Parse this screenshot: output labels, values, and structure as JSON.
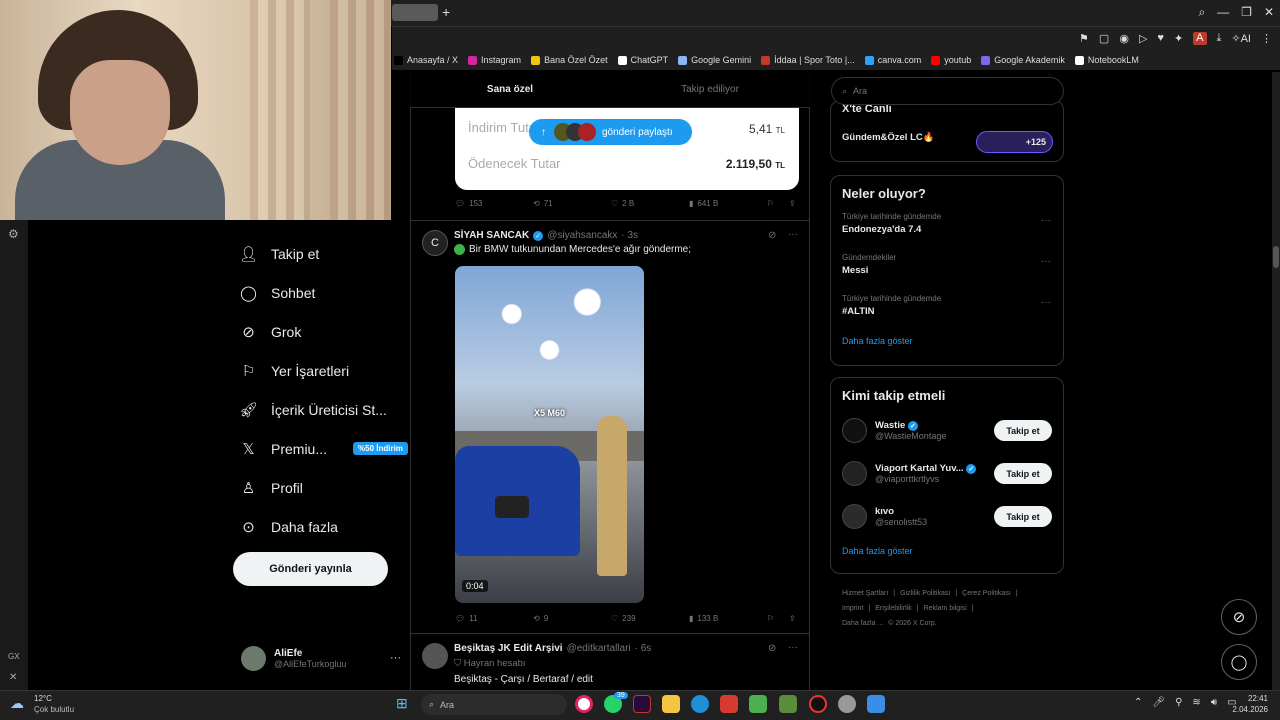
{
  "browser": {
    "bookmarks": [
      "Anasayfa / X",
      "Instagram",
      "Bana Özel Özet",
      "ChatGPT",
      "Google Gemini",
      "İddaa | Spor Toto |...",
      "canva.com",
      "youtub",
      "Google Akademik",
      "NotebookLM"
    ],
    "bookmark_colors": [
      "#000000",
      "#d6249f",
      "#f1c40f",
      "#ffffff",
      "#8ab4f8",
      "#c0392b",
      "#2ba3ff",
      "#ff0000",
      "#7b68ee",
      "#ffffff"
    ]
  },
  "nav": {
    "items": [
      {
        "label": "Takip et",
        "icon": "add-person-icon"
      },
      {
        "label": "Sohbet",
        "icon": "chat-icon"
      },
      {
        "label": "Grok",
        "icon": "grok-icon"
      },
      {
        "label": "Yer İşaretleri",
        "icon": "bookmark-icon"
      },
      {
        "label": "İçerik Üreticisi St...",
        "icon": "rocket-icon"
      },
      {
        "label": "Premiu...",
        "icon": "x-logo-icon"
      },
      {
        "label": "Profil",
        "icon": "person-icon"
      },
      {
        "label": "Daha fazla",
        "icon": "more-circle-icon"
      }
    ],
    "premium_badge": "%50 İndirim",
    "post_button": "Gönderi yayınla"
  },
  "profile": {
    "name": "AliEfe",
    "handle": "@AliEfeTurkogluu",
    "more": "···"
  },
  "feed": {
    "tabs": [
      "Sana özel",
      "Takip ediliyor"
    ],
    "receipt": {
      "row1_label": "İndirim Tutarı",
      "row1_value": "5,41",
      "currency": "TL",
      "row2_label": "Ödenecek Tutar",
      "row2_value": "2.119,50"
    },
    "share_pill": "gönderi paylaştı",
    "tweet1_stats": {
      "replies": "153",
      "reposts": "71",
      "likes": "2 B",
      "views": "641 B"
    },
    "tweet2": {
      "name": "SİYAH SANCAK",
      "handle": "@siyahsancakx",
      "time": "· 3s",
      "text": "Bir BMW tutkunundan Mercedes'e ağır gönderme;",
      "video_caption": "X5 M60",
      "duration": "0:04",
      "stats": {
        "replies": "11",
        "reposts": "9",
        "likes": "239",
        "views": "133 B"
      }
    },
    "tweet3": {
      "name": "Beşiktaş JK Edit Arşivi",
      "handle": "@editkartallari",
      "time": "· 6s",
      "subtitle": "Hayran hesabı",
      "text": "Beşiktaş - Çarşı / Bertaraf / edit"
    }
  },
  "right": {
    "search_placeholder": "Ara",
    "community": {
      "title": "X'te Canlı",
      "room": "Gündem&Özel LC🔥",
      "count": "+125"
    },
    "trends_title": "Neler oluyor?",
    "trends": [
      {
        "meta": "Türkiye tarihinde gündemde",
        "topic": "Endonezya'da 7.4"
      },
      {
        "meta": "Gündemdekiler",
        "topic": "Messi"
      },
      {
        "meta": "Türkiye tarihinde gündemde",
        "topic": "#ALTIN"
      }
    ],
    "show_more": "Daha fazla göster",
    "who_title": "Kimi takip etmeli",
    "who": [
      {
        "name": "Wastie",
        "handle": "@WastieMontage",
        "verified": true,
        "button": "Takip et"
      },
      {
        "name": "Viaport Kartal Yuv...",
        "handle": "@viaporttkrtlyvs",
        "verified": true,
        "button": "Takip et"
      },
      {
        "name": "kıvo",
        "handle": "@senolistt53",
        "verified": false,
        "button": "Takip et"
      }
    ],
    "footer": [
      "Hizmet Şartları",
      "|",
      "Gizlilik Politikası",
      "|",
      "Çerez Politikası",
      "|",
      "Imprint",
      "|",
      "Erişilebilirlik",
      "|",
      "Reklam bilgisi",
      "|",
      "Daha fazla ...",
      "© 2026 X Corp."
    ]
  },
  "taskbar": {
    "weather_temp": "12°C",
    "weather_desc": "Çok bulutlu",
    "search": "Ara",
    "whatsapp_badge": "39",
    "time": "22:41",
    "date": "2.04.2026"
  },
  "side": {
    "gx": "GX"
  }
}
